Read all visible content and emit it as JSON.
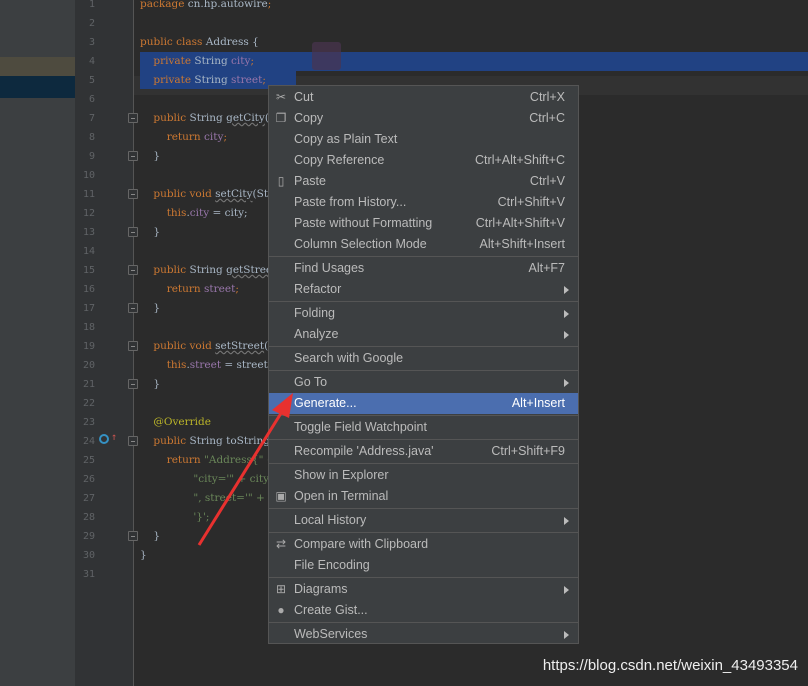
{
  "editor": {
    "lines": [
      {
        "n": "1",
        "t": [
          [
            "package ",
            "kw"
          ],
          [
            "cn.hp.autowire",
            ""
          ],
          [
            ";",
            "kw"
          ]
        ]
      },
      {
        "n": "2",
        "t": []
      },
      {
        "n": "3",
        "t": [
          [
            "public class ",
            "kw"
          ],
          [
            "Address {",
            ""
          ]
        ]
      },
      {
        "n": "4",
        "t": [
          [
            "    private ",
            "kw"
          ],
          [
            "String ",
            ""
          ],
          [
            "city",
            "fld"
          ],
          [
            ";",
            "kw"
          ]
        ]
      },
      {
        "n": "5",
        "t": [
          [
            "    private ",
            "kw"
          ],
          [
            "String ",
            ""
          ],
          [
            "street",
            "fld"
          ],
          [
            ";",
            "kw"
          ]
        ]
      },
      {
        "n": "6",
        "t": []
      },
      {
        "n": "7",
        "t": [
          [
            "    public ",
            "kw"
          ],
          [
            "String ",
            ""
          ],
          [
            "getCity",
            "wav"
          ],
          [
            "() {",
            ""
          ]
        ]
      },
      {
        "n": "8",
        "t": [
          [
            "        return ",
            "kw"
          ],
          [
            "city",
            "fld"
          ],
          [
            ";",
            "kw"
          ]
        ]
      },
      {
        "n": "9",
        "t": [
          [
            "    }",
            ""
          ]
        ]
      },
      {
        "n": "10",
        "t": []
      },
      {
        "n": "11",
        "t": [
          [
            "    public void ",
            "kw"
          ],
          [
            "setCity",
            "wav"
          ],
          [
            "(String city) {",
            ""
          ]
        ]
      },
      {
        "n": "12",
        "t": [
          [
            "        this",
            "kw"
          ],
          [
            ".",
            ""
          ],
          [
            "city",
            "fld"
          ],
          [
            " = city;",
            ""
          ]
        ]
      },
      {
        "n": "13",
        "t": [
          [
            "    }",
            ""
          ]
        ]
      },
      {
        "n": "14",
        "t": []
      },
      {
        "n": "15",
        "t": [
          [
            "    public ",
            "kw"
          ],
          [
            "String ",
            ""
          ],
          [
            "getStreet",
            "wav"
          ],
          [
            "() {",
            ""
          ]
        ]
      },
      {
        "n": "16",
        "t": [
          [
            "        return ",
            "kw"
          ],
          [
            "street",
            "fld"
          ],
          [
            ";",
            "kw"
          ]
        ]
      },
      {
        "n": "17",
        "t": [
          [
            "    }",
            ""
          ]
        ]
      },
      {
        "n": "18",
        "t": []
      },
      {
        "n": "19",
        "t": [
          [
            "    public void ",
            "kw"
          ],
          [
            "setStreet",
            "wav"
          ],
          [
            "(String street) {",
            ""
          ]
        ]
      },
      {
        "n": "20",
        "t": [
          [
            "        this",
            "kw"
          ],
          [
            ".",
            ""
          ],
          [
            "street",
            "fld"
          ],
          [
            " = street;",
            ""
          ]
        ]
      },
      {
        "n": "21",
        "t": [
          [
            "    }",
            ""
          ]
        ]
      },
      {
        "n": "22",
        "t": []
      },
      {
        "n": "23",
        "t": [
          [
            "    @Override",
            "ann"
          ]
        ]
      },
      {
        "n": "24",
        "t": [
          [
            "    public ",
            "kw"
          ],
          [
            "String ",
            ""
          ],
          [
            "toString() {",
            ""
          ]
        ]
      },
      {
        "n": "25",
        "t": [
          [
            "        return ",
            "kw"
          ],
          [
            "\"Address{\" +",
            "str"
          ]
        ]
      },
      {
        "n": "26",
        "t": [
          [
            "                \"city='\" + city + '\\'' +",
            "str"
          ]
        ]
      },
      {
        "n": "27",
        "t": [
          [
            "                \", street='\" + street + '\\'' +",
            "str"
          ]
        ]
      },
      {
        "n": "28",
        "t": [
          [
            "                '}';",
            "str"
          ]
        ]
      },
      {
        "n": "29",
        "t": [
          [
            "    }",
            ""
          ]
        ]
      },
      {
        "n": "30",
        "t": [
          [
            "}",
            ""
          ]
        ]
      },
      {
        "n": "31",
        "t": []
      }
    ],
    "fold_lines": [
      7,
      9,
      11,
      13,
      15,
      17,
      19,
      21,
      24,
      29
    ]
  },
  "context_menu": {
    "groups": [
      [
        {
          "label": "Cut",
          "shortcut": "Ctrl+X",
          "icon": "scissors-icon",
          "glyph": "✂"
        },
        {
          "label": "Copy",
          "shortcut": "Ctrl+C",
          "icon": "copy-icon",
          "glyph": "❐"
        },
        {
          "label": "Copy as Plain Text",
          "shortcut": ""
        },
        {
          "label": "Copy Reference",
          "shortcut": "Ctrl+Alt+Shift+C"
        },
        {
          "label": "Paste",
          "shortcut": "Ctrl+V",
          "icon": "clipboard-icon",
          "glyph": "▯"
        },
        {
          "label": "Paste from History...",
          "shortcut": "Ctrl+Shift+V"
        },
        {
          "label": "Paste without Formatting",
          "shortcut": "Ctrl+Alt+Shift+V"
        },
        {
          "label": "Column Selection Mode",
          "shortcut": "Alt+Shift+Insert"
        }
      ],
      [
        {
          "label": "Find Usages",
          "shortcut": "Alt+F7"
        },
        {
          "label": "Refactor",
          "submenu": true
        }
      ],
      [
        {
          "label": "Folding",
          "submenu": true
        },
        {
          "label": "Analyze",
          "submenu": true
        }
      ],
      [
        {
          "label": "Search with Google"
        }
      ],
      [
        {
          "label": "Go To",
          "submenu": true
        },
        {
          "label": "Generate...",
          "shortcut": "Alt+Insert",
          "highlighted": true
        }
      ],
      [
        {
          "label": "Toggle Field Watchpoint"
        }
      ],
      [
        {
          "label": "Recompile 'Address.java'",
          "shortcut": "Ctrl+Shift+F9"
        }
      ],
      [
        {
          "label": "Show in Explorer"
        },
        {
          "label": "Open in Terminal",
          "icon": "terminal-icon",
          "glyph": "▣"
        }
      ],
      [
        {
          "label": "Local History",
          "submenu": true
        }
      ],
      [
        {
          "label": "Compare with Clipboard",
          "icon": "compare-icon",
          "glyph": "⇄"
        },
        {
          "label": "File Encoding"
        }
      ],
      [
        {
          "label": "Diagrams",
          "submenu": true,
          "icon": "diagram-icon",
          "glyph": "⊞"
        },
        {
          "label": "Create Gist...",
          "icon": "github-icon",
          "glyph": "●"
        }
      ],
      [
        {
          "label": "WebServices",
          "submenu": true
        }
      ]
    ]
  },
  "watermark": "https://blog.csdn.net/weixin_43493354",
  "colors": {
    "selection": "#214283",
    "highlight": "#4b6eaf",
    "arrow": "#e8312f"
  }
}
